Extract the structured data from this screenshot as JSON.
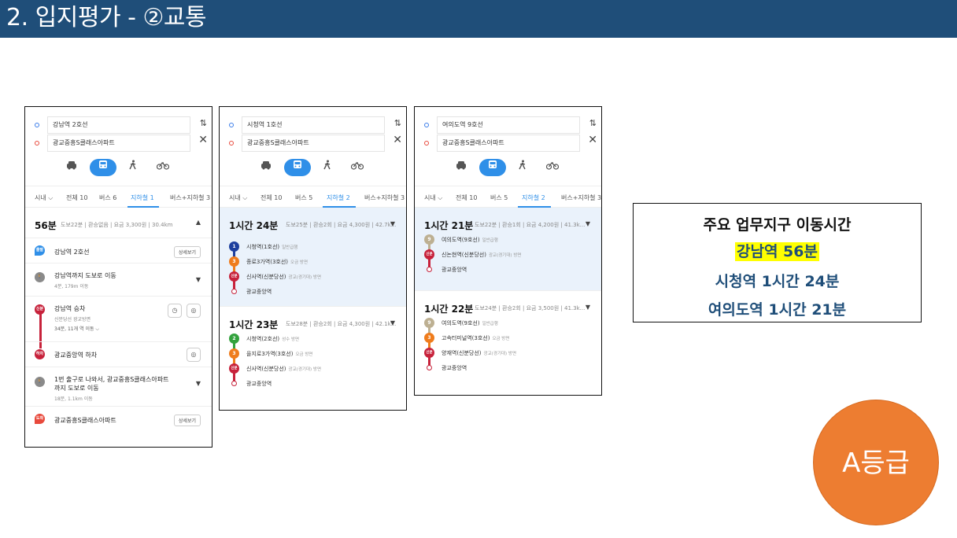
{
  "slide": {
    "title": "2. 입지평가 - ②교통"
  },
  "panels": [
    {
      "origin": "강남역 2호선",
      "destination": "광교중흥S클래스아파트",
      "tabs": [
        "시내 ⌵",
        "전체 10",
        "버스 6",
        "지하철 1",
        "버스+지하철 3"
      ],
      "active_tab": "지하철 1",
      "summary": {
        "time": "56분",
        "meta": "도보22분 | 환승없음 | 요금 3,300원 | 30.4km"
      },
      "steps": [
        {
          "badge": "출발",
          "title": "강남역 2호선",
          "button": "상세보기"
        },
        {
          "badge": "",
          "title": "강남역까지 도보로 이동",
          "sub": "4분, 179m 이동"
        },
        {
          "badge": "신분",
          "title": "강남역 승차",
          "sub": "신분당선 광교방면",
          "sub2": "34분, 11개 역 이동 ⌵"
        },
        {
          "badge": "하차",
          "title": "광교중앙역 하차"
        },
        {
          "badge": "",
          "title": "1번 출구로 나와서, 광교중흥S클래스아파트",
          "title2": "까지 도보로 이동",
          "sub": "18분, 1.1km 이동"
        },
        {
          "badge": "도착",
          "title": "광교중흥S클래스아파트",
          "button": "상세보기"
        }
      ]
    },
    {
      "origin": "시청역 1호선",
      "destination": "광교중흥S클래스아파트",
      "tabs": [
        "시내 ⌵",
        "전체 10",
        "버스 5",
        "지하철 2",
        "버스+지하철 3"
      ],
      "active_tab": "지하철 2",
      "routes": [
        {
          "time": "1시간 24분",
          "meta": "도보25분 | 환승2회 | 요금 4,300원 | 42.7k...",
          "stops": [
            {
              "badge": "1",
              "color": "#1d3f9e",
              "name": "시청역(1호선)",
              "note": "일반급행"
            },
            {
              "badge": "3",
              "color": "#ef7c1c",
              "name": "종로3가역(3호선)",
              "note": "오금 방면"
            },
            {
              "badge": "신분",
              "color": "#c7223b",
              "name": "신사역(신분당선)",
              "note": "광교(경기대) 방면"
            },
            {
              "badge": "",
              "color": "#c7223b",
              "name": "광교중앙역",
              "note": ""
            }
          ]
        },
        {
          "time": "1시간 23분",
          "meta": "도보28분 | 환승2회 | 요금 4,300원 | 42.1k...",
          "stops": [
            {
              "badge": "2",
              "color": "#33a23d",
              "name": "시청역(2호선)",
              "note": "성수 방면"
            },
            {
              "badge": "3",
              "color": "#ef7c1c",
              "name": "을지로3가역(3호선)",
              "note": "오금 방면"
            },
            {
              "badge": "신분",
              "color": "#c7223b",
              "name": "신사역(신분당선)",
              "note": "광교(경기대) 방면"
            },
            {
              "badge": "",
              "color": "#c7223b",
              "name": "광교중앙역",
              "note": ""
            }
          ]
        }
      ]
    },
    {
      "origin": "여의도역 9호선",
      "destination": "광교중흥S클래스아파트",
      "tabs": [
        "시내 ⌵",
        "전체 10",
        "버스 5",
        "지하철 2",
        "버스+지하철 3"
      ],
      "active_tab": "지하철 2",
      "routes": [
        {
          "time": "1시간 21분",
          "meta": "도보22분 | 환승1회 | 요금 4,200원 | 41.3k...",
          "stops": [
            {
              "badge": "9",
              "color": "#bdb092",
              "name": "여의도역(9호선)",
              "note": "일반급행"
            },
            {
              "badge": "신분",
              "color": "#c7223b",
              "name": "신논현역(신분당선)",
              "note": "광교(경기대) 방면"
            },
            {
              "badge": "",
              "color": "#c7223b",
              "name": "광교중앙역",
              "note": ""
            }
          ]
        },
        {
          "time": "1시간 22분",
          "meta": "도보24분 | 환승2회 | 요금 3,500원 | 41.3k...",
          "stops": [
            {
              "badge": "9",
              "color": "#bdb092",
              "name": "여의도역(9호선)",
              "note": "일반급행"
            },
            {
              "badge": "3",
              "color": "#ef7c1c",
              "name": "고속터미널역(3호선)",
              "note": "오금 방면"
            },
            {
              "badge": "신분",
              "color": "#c7223b",
              "name": "양재역(신분당선)",
              "note": "광교(경기대) 방면"
            },
            {
              "badge": "",
              "color": "#c7223b",
              "name": "광교중앙역",
              "note": ""
            }
          ]
        }
      ]
    }
  ],
  "info": {
    "title": "주요 업무지구 이동시간",
    "line1": "강남역 56분",
    "line2": "시청역 1시간 24분",
    "line3": "여의도역 1시간 21분"
  },
  "grade": "A등급",
  "icons": {
    "swap": "⇅",
    "close": "✕",
    "car": "car-icon",
    "bus": "bus-icon",
    "walk": "walk-icon",
    "bike": "bike-icon"
  }
}
